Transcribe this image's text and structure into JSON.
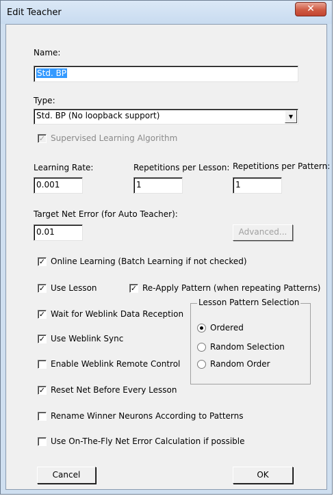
{
  "window": {
    "title": "Edit Teacher",
    "close_icon": "x-icon"
  },
  "name": {
    "label": "Name:",
    "value": "Std. BP"
  },
  "type": {
    "label": "Type:",
    "value": "Std. BP (No loopback support)"
  },
  "supervised": {
    "label": "Supervised Learning Algorithm",
    "checked": true
  },
  "learning_rate": {
    "label": "Learning Rate:",
    "value": "0.001"
  },
  "reps_lesson": {
    "label": "Repetitions per Lesson:",
    "value": "1"
  },
  "reps_pattern": {
    "label": "Repetitions per Pattern:",
    "value": "1"
  },
  "target_error": {
    "label": "Target Net Error (for Auto Teacher):",
    "value": "0.01"
  },
  "advanced_button": "Advanced...",
  "options": {
    "online_learning": "Online Learning (Batch Learning if not checked)",
    "use_lesson": "Use Lesson",
    "reapply_pattern": "Re-Apply Pattern (when repeating Patterns)",
    "wait_weblink": "Wait for Weblink Data Reception",
    "use_weblink_sync": "Use Weblink Sync",
    "enable_remote": "Enable Weblink Remote Control",
    "reset_net": "Reset Net Before Every Lesson",
    "rename_winner": "Rename Winner Neurons According to Patterns",
    "on_the_fly": "Use On-The-Fly Net Error Calculation if possible"
  },
  "lesson_pattern": {
    "title": "Lesson Pattern Selection",
    "ordered": "Ordered",
    "random_selection": "Random Selection",
    "random_order": "Random Order",
    "selected": "Ordered"
  },
  "buttons": {
    "cancel": "Cancel",
    "ok": "OK"
  },
  "check_mark": "✓",
  "dropdown_arrow": "▼"
}
